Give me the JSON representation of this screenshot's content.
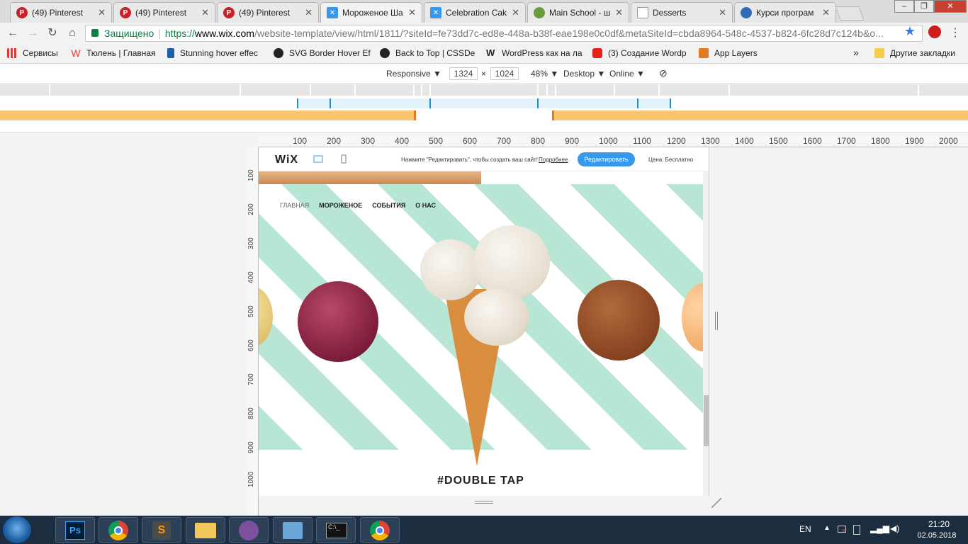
{
  "browser": {
    "tabs": [
      {
        "title": "(49) Pinterest",
        "icon": "pinterest-icon",
        "color": "#cb2027"
      },
      {
        "title": "(49) Pinterest",
        "icon": "pinterest-icon",
        "color": "#cb2027"
      },
      {
        "title": "(49) Pinterest",
        "icon": "pinterest-icon",
        "color": "#cb2027"
      },
      {
        "title": "Мороженое Ша",
        "icon": "wix-icon",
        "color": "#3899ec"
      },
      {
        "title": "Celebration Cak",
        "icon": "wix-icon",
        "color": "#3899ec"
      },
      {
        "title": "Main School - ш",
        "icon": "globe-icon",
        "color": "#6a9a3a"
      },
      {
        "title": "Desserts",
        "icon": "page-icon",
        "color": "#9e9e9e"
      },
      {
        "title": "Курси програм",
        "icon": "globe-icon",
        "color": "#2c6eb5"
      }
    ],
    "address": {
      "secure_label": "Защищено",
      "protocol": "https://",
      "host": "www.wix.com",
      "path": "/website-template/view/html/1811/?siteId=fe73dd7c-ed8e-448a-b38f-eae198e0c0df&metaSiteId=cbda8964-548c-4537-b824-6fc28d7c124b&o..."
    },
    "bookmarks": [
      {
        "label": "Сервисы",
        "icon": "apps-icon"
      },
      {
        "label": "Тюлень | Главная",
        "icon": "w-icon"
      },
      {
        "label": "Stunning hover effec",
        "icon": "p-icon"
      },
      {
        "label": "SVG Border Hover Ef",
        "icon": "github-icon"
      },
      {
        "label": "Back to Top | CSSDe",
        "icon": "github-icon"
      },
      {
        "label": "WordPress как на ла",
        "icon": "w-icon"
      },
      {
        "label": "(3) Создание Wordp",
        "icon": "youtube-icon"
      },
      {
        "label": "App Layers",
        "icon": "app-layers-icon"
      },
      {
        "label": "»",
        "icon": ""
      },
      {
        "label": "Другие закладки",
        "icon": "folder-icon"
      }
    ]
  },
  "devtools": {
    "mode": "Responsive",
    "width": "1324",
    "height": "1024",
    "times": "×",
    "zoom": "48%",
    "device_type": "Desktop",
    "network": "Online"
  },
  "ruler": {
    "top": [
      "100",
      "200",
      "300",
      "400",
      "500",
      "600",
      "700",
      "800",
      "900",
      "1000",
      "1100",
      "1200",
      "1300",
      "1400",
      "1500",
      "1600",
      "1700",
      "1800",
      "1900",
      "2000"
    ],
    "left": [
      "100",
      "200",
      "300",
      "400",
      "500",
      "600",
      "700",
      "800",
      "900",
      "1000"
    ]
  },
  "site": {
    "wix_logo": "WiX",
    "editor_prompt": "Нажмите \"Редактировать\", чтобы создать ваш сайт!",
    "more_link": "Подробнее",
    "edit_button": "Редактировать",
    "price_label": "Цена: Бесплатно",
    "nav": [
      "ГЛАВНАЯ",
      "МОРОЖЕНОЕ",
      "СОБЫТИЯ",
      "О НАС"
    ],
    "hashtag": "#DOUBLE TAP",
    "colors": {
      "mint": "#b7e6d5",
      "berry": "#8a2342",
      "chocolate": "#8b4a22",
      "cone": "#d88d3f",
      "vanilla": "#f1ece3"
    }
  },
  "taskbar": {
    "apps": [
      "photoshop-icon",
      "chrome-icon",
      "sublime-icon",
      "explorer-icon",
      "viber-icon",
      "control-panel-icon",
      "cmd-icon",
      "chrome-icon"
    ],
    "lang": "EN",
    "time": "21:20",
    "date": "02.05.2018"
  }
}
